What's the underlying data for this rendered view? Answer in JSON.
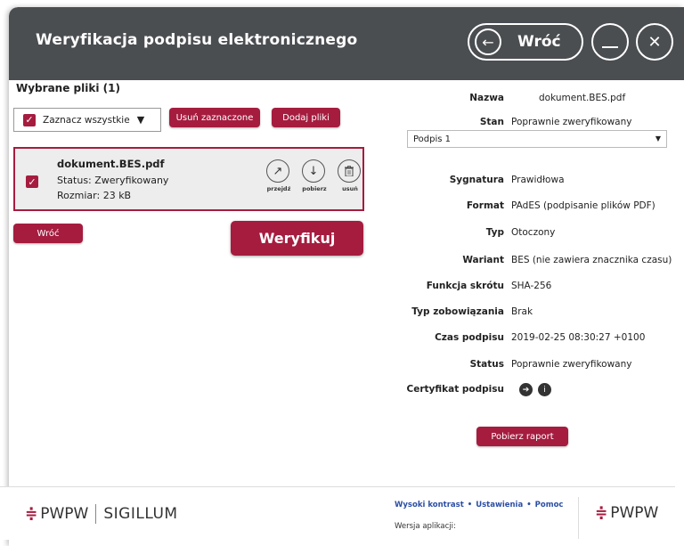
{
  "header": {
    "title": "Weryfikacja podpisu elektronicznego",
    "back_label": "Wróć",
    "back_icon": "arrow-left-icon",
    "minimize_icon": "minimize-icon",
    "close_icon": "close-icon"
  },
  "files": {
    "title": "Wybrane pliki (1)",
    "select_all_label": "Zaznacz wszystkie",
    "remove_selected_label": "Usuń zaznaczone",
    "add_files_label": "Dodaj pliki",
    "items": [
      {
        "name": "dokument.BES.pdf",
        "status": "Status: Zweryfikowany",
        "size": "Rozmiar: 23 kB",
        "actions": [
          {
            "label": "przejdź",
            "icon": "arrow-up-right-icon"
          },
          {
            "label": "pobierz",
            "icon": "arrow-down-icon"
          },
          {
            "label": "usuń",
            "icon": "trash-icon"
          }
        ]
      }
    ],
    "back_label": "Wróć",
    "verify_label": "Weryfikuj"
  },
  "details": {
    "name_label": "Nazwa",
    "name_value": "dokument.BES.pdf",
    "state_label": "Stan",
    "state_value": "Poprawnie zweryfikowany",
    "signature_select": "Podpis 1",
    "fields": [
      {
        "label": "Sygnatura",
        "value": "Prawidłowa"
      },
      {
        "label": "Format",
        "value": "PAdES (podpisanie plików PDF)"
      },
      {
        "label": "Typ",
        "value": "Otoczony"
      },
      {
        "label": "Wariant",
        "value": "BES (nie zawiera znacznika czasu)"
      },
      {
        "label": "Funkcja skrótu",
        "value": "SHA-256"
      },
      {
        "label": "Typ zobowiązania",
        "value": "Brak"
      },
      {
        "label": "Czas podpisu",
        "value": "2019-02-25 08:30:27 +0100"
      },
      {
        "label": "Status",
        "value": "Poprawnie zweryfikowany"
      }
    ],
    "certificate_label": "Certyfikat podpisu",
    "report_button": "Pobierz raport"
  },
  "footer": {
    "logo_left_text": "PWPW",
    "logo_left_sub": "SIGILLUM",
    "links": [
      "Wysoki kontrast",
      "Ustawienia",
      "Pomoc"
    ],
    "version_label": "Wersja aplikacji:",
    "logo_right_text": "PWPW"
  },
  "colors": {
    "accent": "#a51c3f",
    "header_bg": "#4b4e51",
    "link": "#2c4fa5"
  }
}
